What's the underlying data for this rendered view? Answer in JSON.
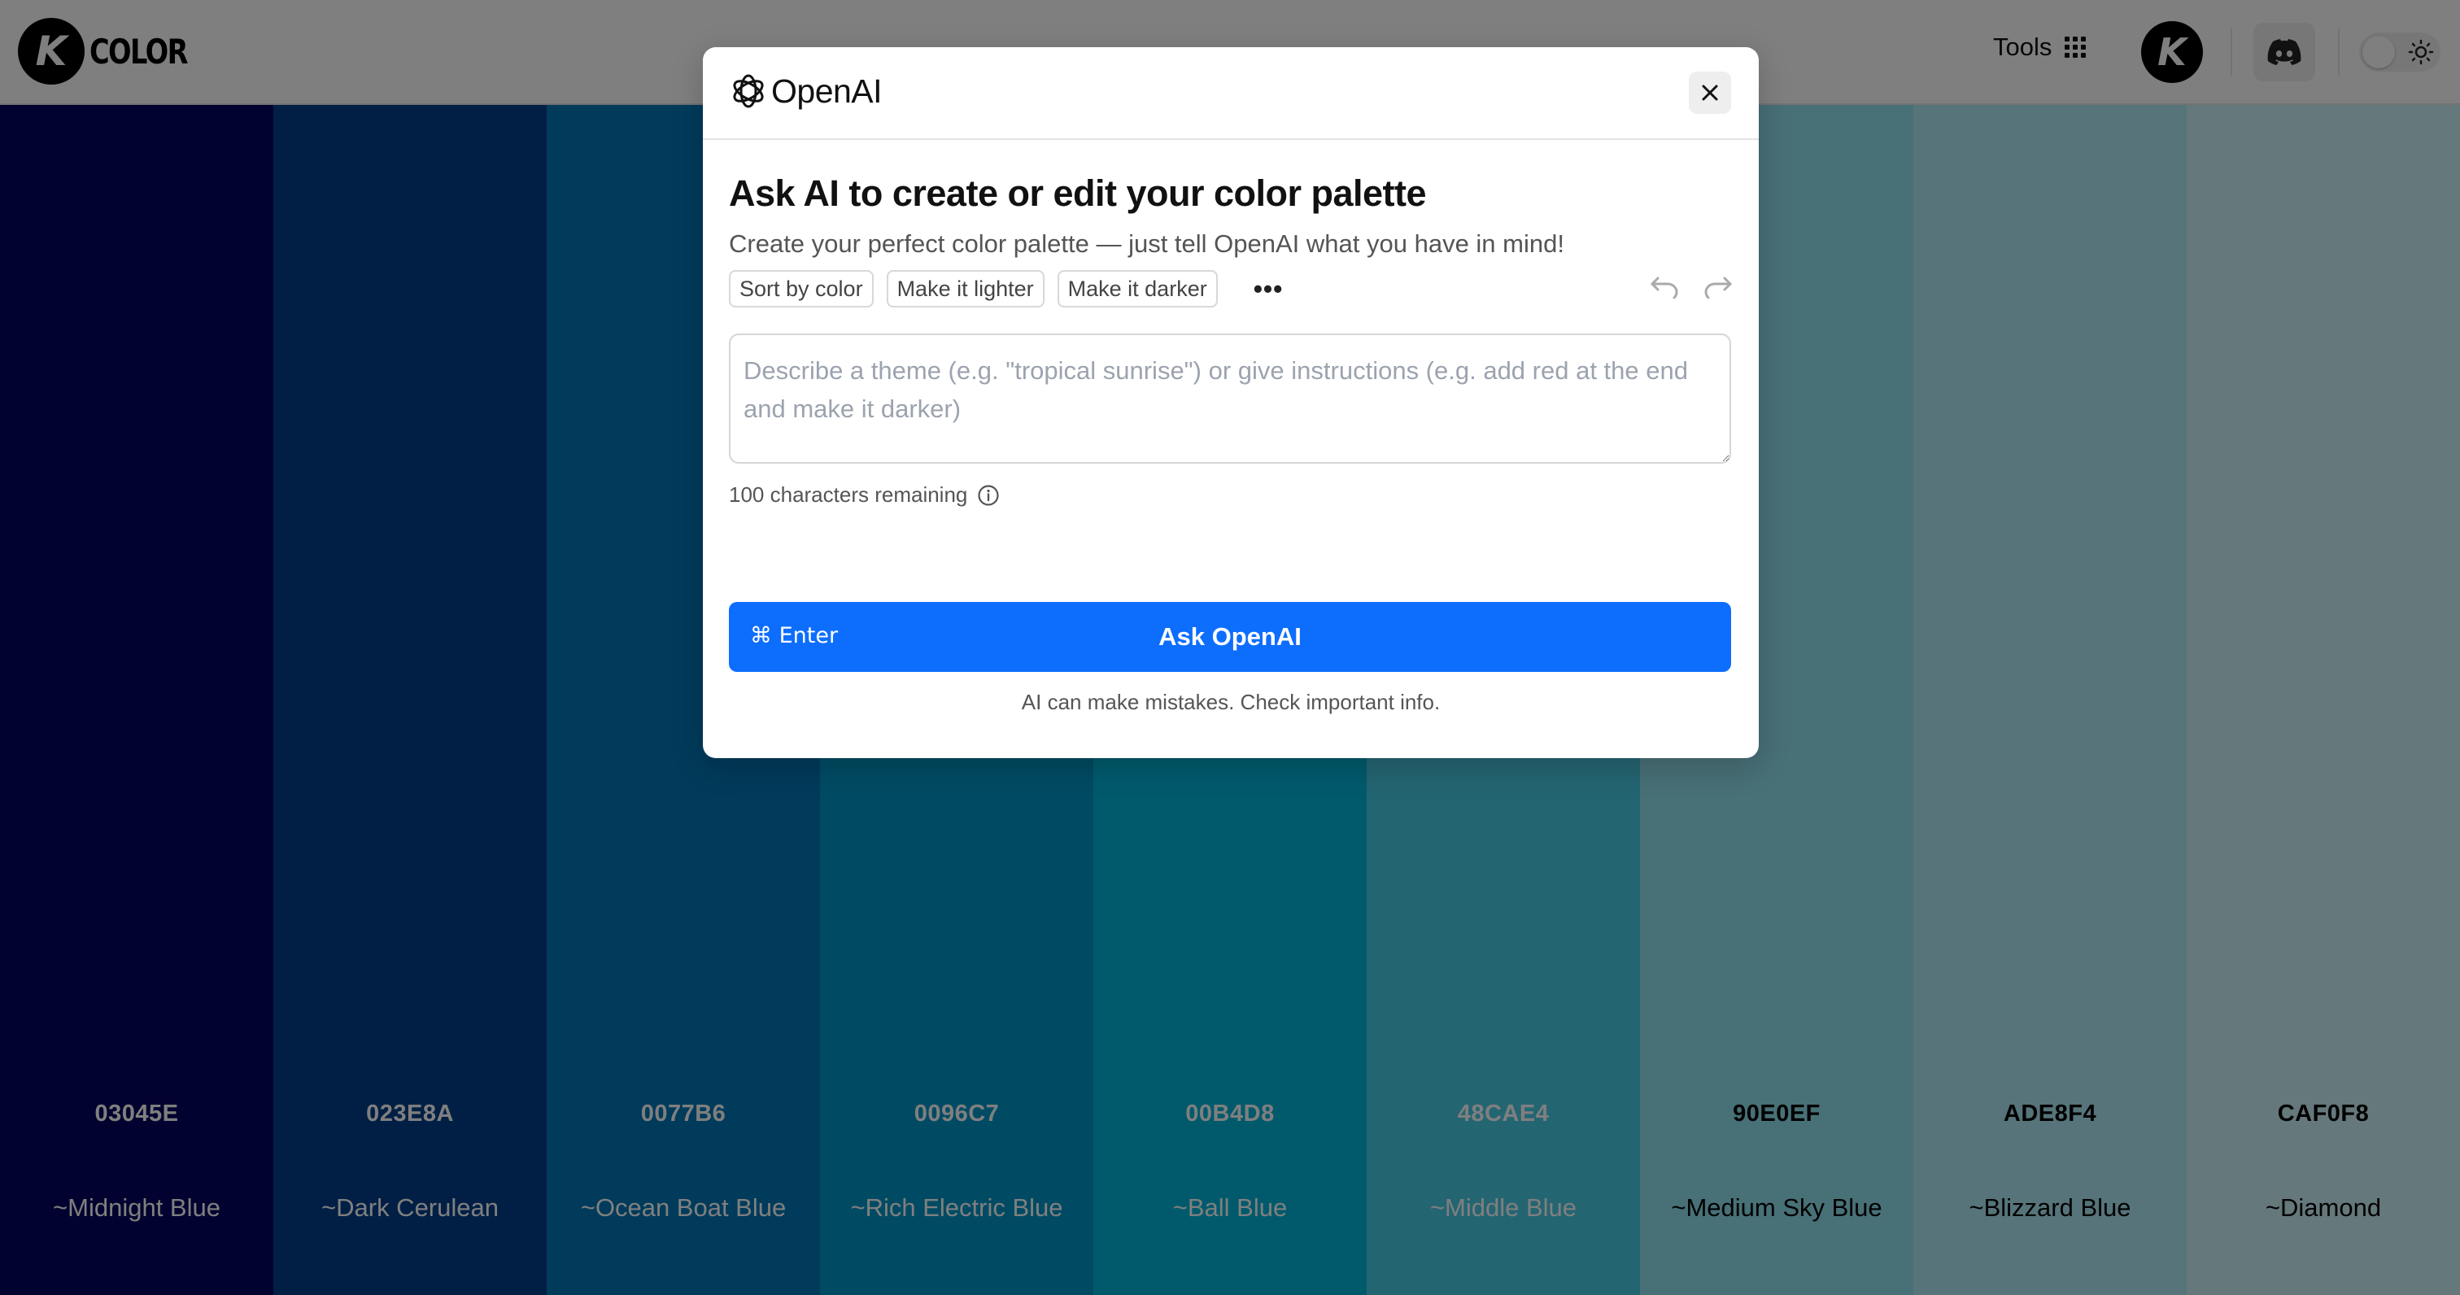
{
  "header": {
    "logo_letter": "K",
    "logo_text": "COLOR",
    "tools_label": "Tools",
    "avatar_letter": "K"
  },
  "palette": [
    {
      "hex": "03045E",
      "name": "~Midnight Blue",
      "color": "#03045E",
      "text_color": "#ffffff"
    },
    {
      "hex": "023E8A",
      "name": "~Dark Cerulean",
      "color": "#023E8A",
      "text_color": "#ffffff"
    },
    {
      "hex": "0077B6",
      "name": "~Ocean Boat Blue",
      "color": "#0077B6",
      "text_color": "#ffffff"
    },
    {
      "hex": "0096C7",
      "name": "~Rich Electric Blue",
      "color": "#0096C7",
      "text_color": "#ffffff"
    },
    {
      "hex": "00B4D8",
      "name": "~Ball Blue",
      "color": "#00B4D8",
      "text_color": "#ffffff"
    },
    {
      "hex": "48CAE4",
      "name": "~Middle Blue",
      "color": "#48CAE4",
      "text_color": "#ffffff"
    },
    {
      "hex": "90E0EF",
      "name": "~Medium Sky Blue",
      "color": "#90E0EF",
      "text_color": "#000000"
    },
    {
      "hex": "ADE8F4",
      "name": "~Blizzard Blue",
      "color": "#ADE8F4",
      "text_color": "#000000"
    },
    {
      "hex": "CAF0F8",
      "name": "~Diamond",
      "color": "#CAF0F8",
      "text_color": "#000000"
    }
  ],
  "modal": {
    "brand": "OpenAI",
    "title": "Ask AI to create or edit your color palette",
    "subtitle": "Create your perfect color palette — just tell OpenAI what you have in mind!",
    "chips": [
      "Sort by color",
      "Make it lighter",
      "Make it darker"
    ],
    "more_label": "•••",
    "textarea_placeholder": "Describe a theme (e.g. \"tropical sunrise\") or give instructions (e.g. add red at the end and make it darker)",
    "remaining_text": "100 characters remaining",
    "shortcut": "⌘ Enter",
    "ask_button": "Ask OpenAI",
    "disclaimer": "AI can make mistakes. Check important info.",
    "accent": "#0d6efd"
  }
}
